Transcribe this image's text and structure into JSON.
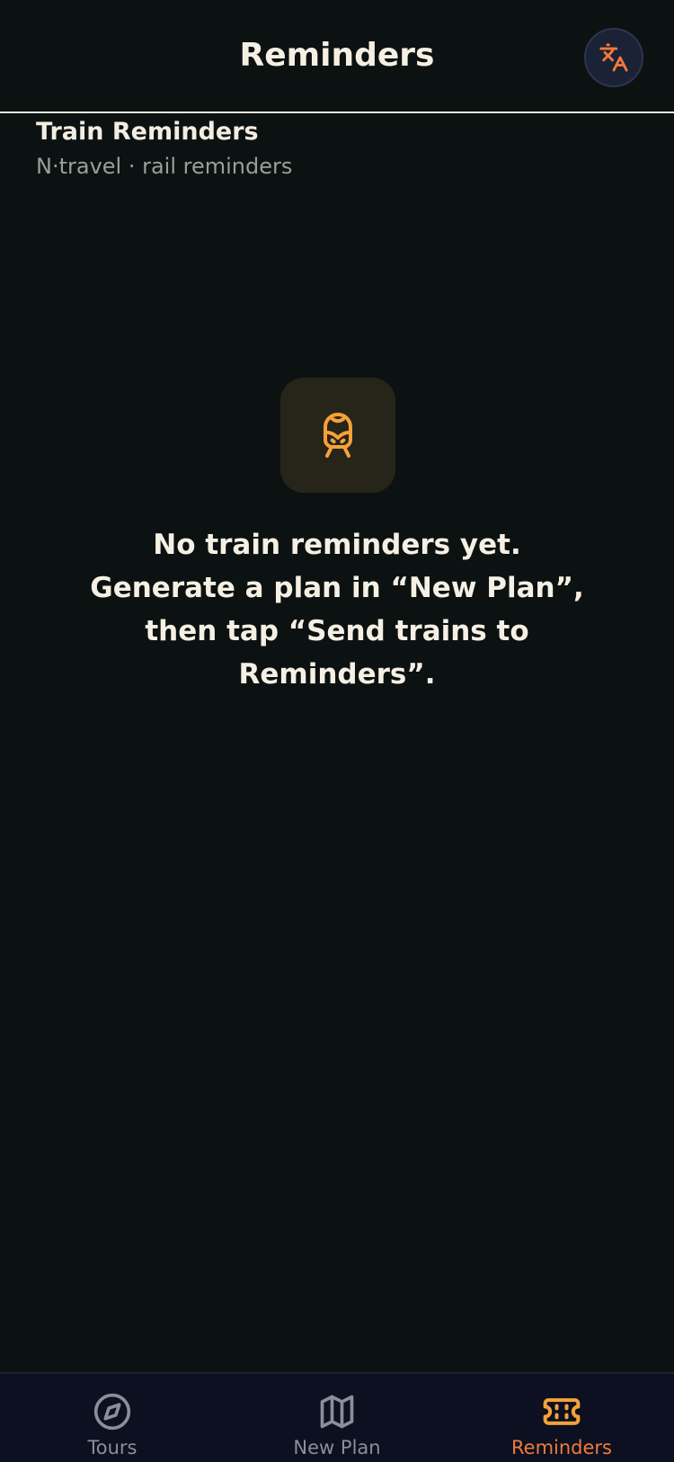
{
  "header": {
    "title": "Reminders",
    "language_icon": "translate-icon"
  },
  "section": {
    "title": "Train Reminders",
    "subtitle": "N·travel · rail reminders"
  },
  "empty_state": {
    "icon": "train-icon",
    "message": "No train reminders yet. Generate a plan in “New Plan”, then tap “Send trains to Reminders”."
  },
  "tabbar": {
    "tabs": [
      {
        "label": "Tours",
        "icon": "compass-icon",
        "active": false
      },
      {
        "label": "New Plan",
        "icon": "map-icon",
        "active": false
      },
      {
        "label": "Reminders",
        "icon": "ticket-icon",
        "active": true
      }
    ]
  },
  "colors": {
    "background": "#0c1211",
    "accent": "#f5a13a",
    "active_tab_label": "#f07a3c",
    "inactive": "#8a8f99"
  }
}
